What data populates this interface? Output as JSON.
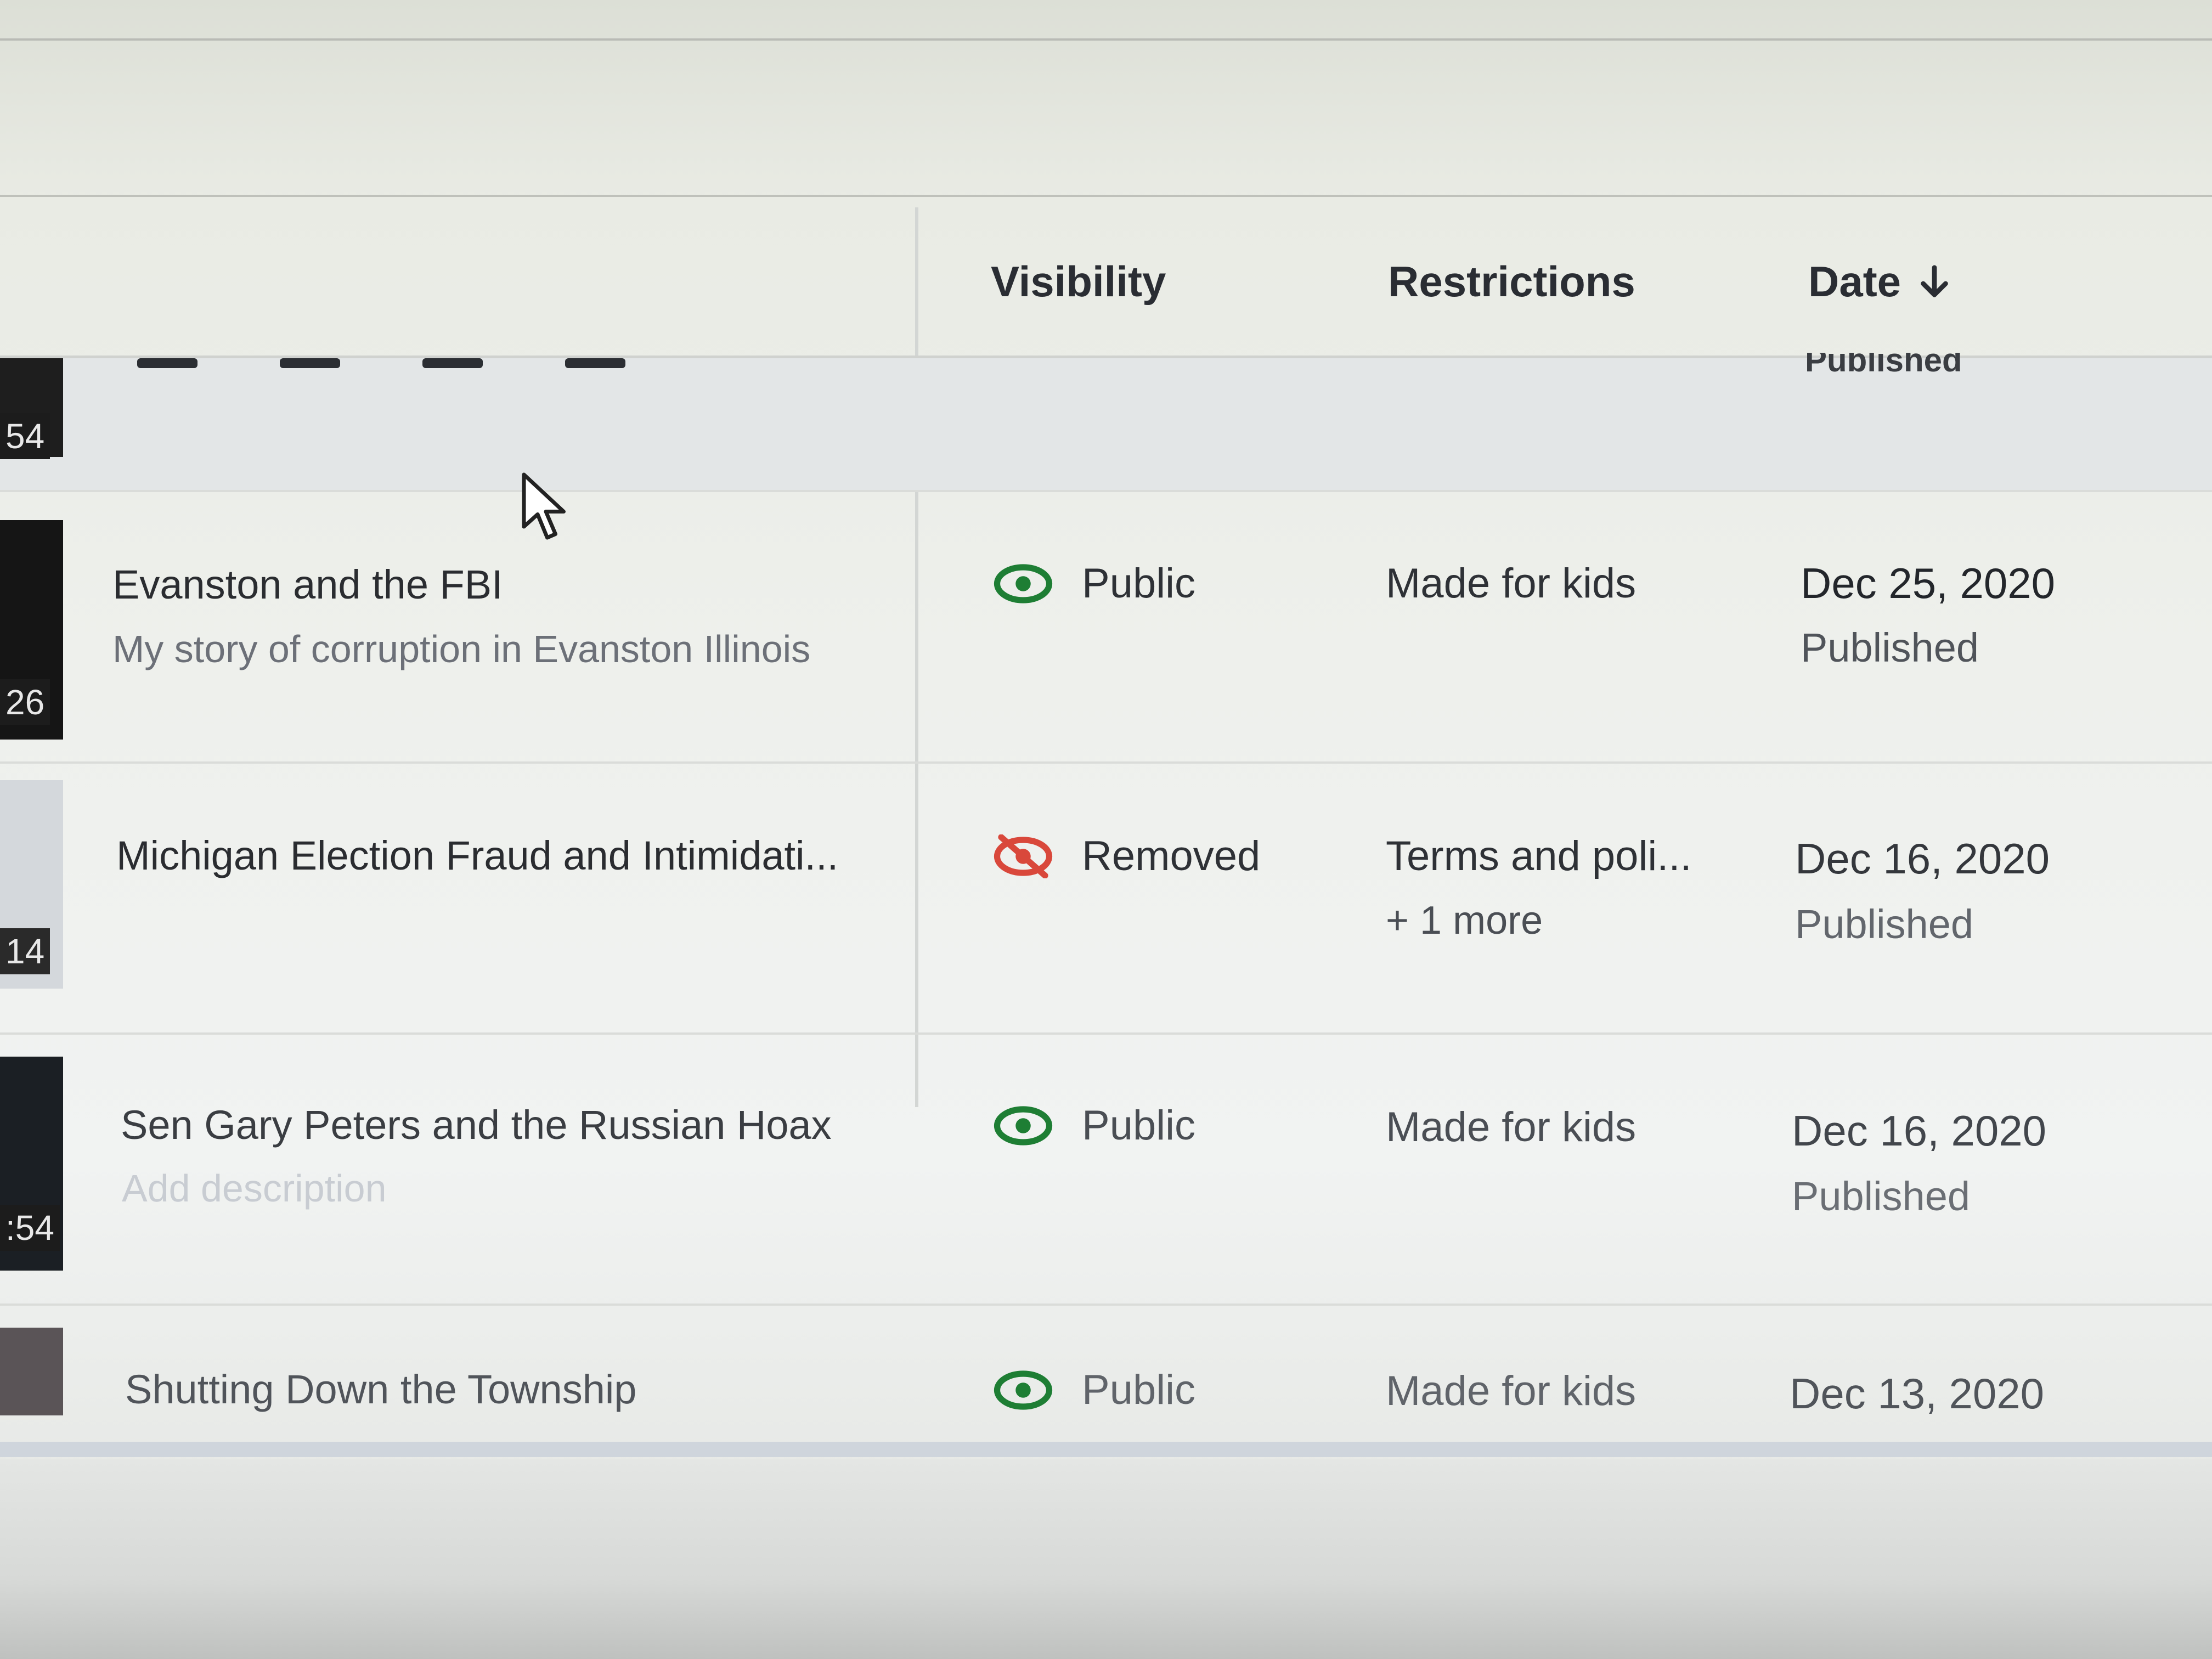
{
  "table": {
    "headers": {
      "visibility": "Visibility",
      "restrictions": "Restrictions",
      "date": "Date"
    },
    "partial_row": {
      "duration": "54",
      "date_status": "Published"
    },
    "rows": [
      {
        "duration": "26",
        "title": "Evanston and the FBI",
        "description": "My story of corruption in Evanston Illinois",
        "visibility": "Public",
        "visibility_icon": "eye-icon",
        "restrictions": "Made for kids",
        "restrictions_more": "",
        "date": "Dec 25, 2020",
        "date_status": "Published"
      },
      {
        "duration": "14",
        "title": "Michigan Election Fraud and Intimidati...",
        "description": "",
        "visibility": "Removed",
        "visibility_icon": "eye-off-icon",
        "restrictions": "Terms and poli...",
        "restrictions_more": "+ 1 more",
        "date": "Dec 16, 2020",
        "date_status": "Published"
      },
      {
        "duration": ":54",
        "title": "Sen Gary Peters and the Russian Hoax",
        "description": "Add description",
        "visibility": "Public",
        "visibility_icon": "eye-icon",
        "restrictions": "Made for kids",
        "restrictions_more": "",
        "date": "Dec 16, 2020",
        "date_status": "Published"
      },
      {
        "duration": "",
        "title": "Shutting Down the Township",
        "description": "",
        "visibility": "Public",
        "visibility_icon": "eye-icon",
        "restrictions": "Made for kids",
        "restrictions_more": "",
        "date": "Dec 13, 2020",
        "date_status": ""
      }
    ]
  },
  "colors": {
    "public_icon": "#1e7e34",
    "removed_icon": "#d9483b",
    "text_primary": "#2a2c30",
    "text_secondary": "#6c7078"
  }
}
